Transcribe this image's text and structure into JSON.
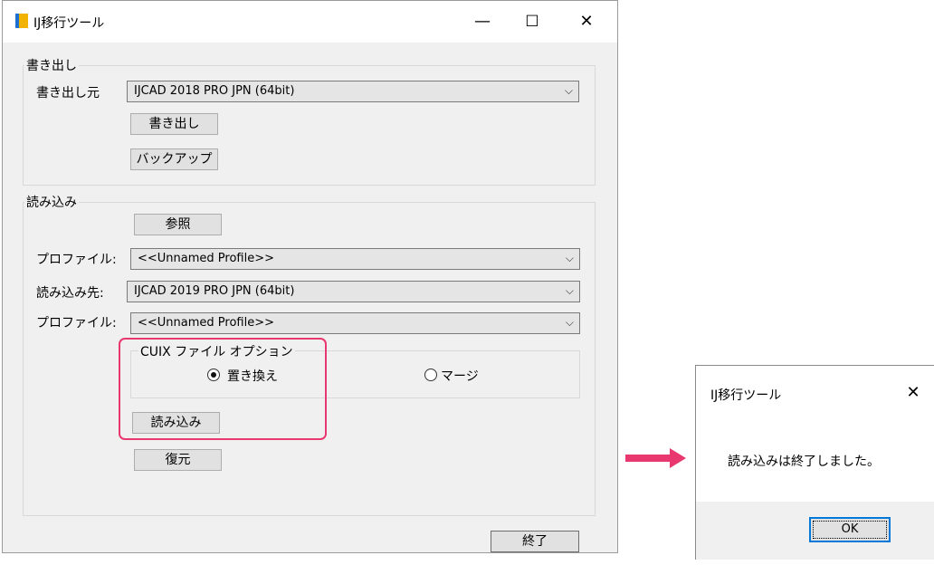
{
  "main_window": {
    "title": "IJ移行ツール",
    "caption_buttons": {
      "minimize": "—",
      "maximize": "☐",
      "close": "✕"
    },
    "export_group": {
      "legend": "書き出し",
      "source_label": "書き出し元",
      "source_value": "IJCAD 2018 PRO JPN (64bit)",
      "export_button": "書き出し",
      "backup_button": "バックアップ"
    },
    "import_group": {
      "legend": "読み込み",
      "browse_button": "参照",
      "profile_label_1": "プロファイル:",
      "profile_value_1": "<<Unnamed Profile>>",
      "target_label": "読み込み先:",
      "target_value": "IJCAD 2019 PRO JPN (64bit)",
      "profile_label_2": "プロファイル:",
      "profile_value_2": "<<Unnamed Profile>>",
      "cuix_group": {
        "legend": "CUIX ファイル オプション",
        "option_replace": "置き換え",
        "option_merge": "マージ",
        "selected": "置き換え"
      },
      "import_button": "読み込み",
      "restore_button": "復元"
    },
    "exit_button": "終了"
  },
  "dialog": {
    "title": "IJ移行ツール",
    "close": "✕",
    "message": "読み込みは終了しました。",
    "ok_button": "OK"
  },
  "colors": {
    "highlight": "#e8386f",
    "arrow": "#e8386f",
    "focus_border": "#0078d7"
  }
}
